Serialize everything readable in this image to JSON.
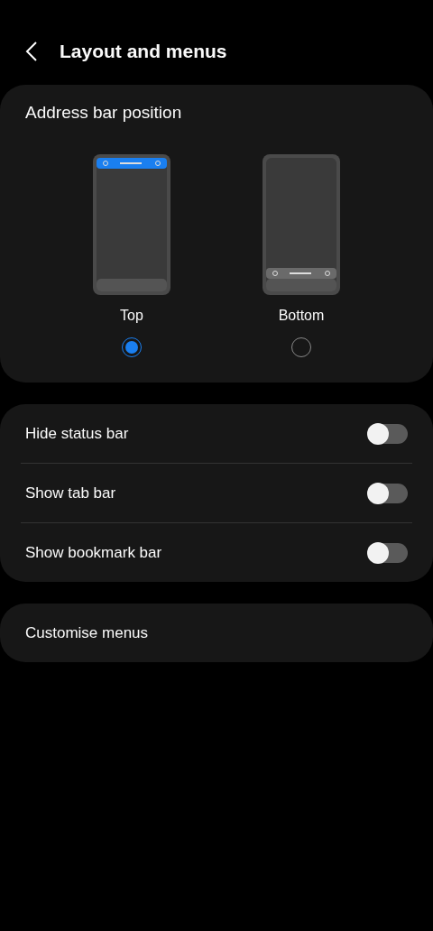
{
  "header": {
    "title": "Layout and menus"
  },
  "address_bar": {
    "title": "Address bar position",
    "options": [
      {
        "label": "Top",
        "kind": "top",
        "selected": true
      },
      {
        "label": "Bottom",
        "kind": "bottom",
        "selected": false
      }
    ]
  },
  "toggles": [
    {
      "label": "Hide status bar",
      "on": false
    },
    {
      "label": "Show tab bar",
      "on": false
    },
    {
      "label": "Show bookmark bar",
      "on": false
    }
  ],
  "menu_item": {
    "label": "Customise menus"
  }
}
